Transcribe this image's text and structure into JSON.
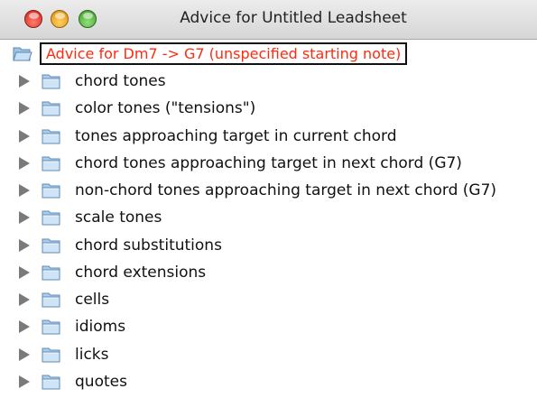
{
  "window": {
    "title": "Advice for Untitled Leadsheet"
  },
  "tree": {
    "root_label": "Advice for Dm7 -> G7 (unspecified starting note)",
    "root_color": "#ff2a10",
    "items": [
      {
        "label": "chord tones"
      },
      {
        "label": "color tones (\"tensions\")"
      },
      {
        "label": "tones approaching target in current chord"
      },
      {
        "label": "chord tones approaching target in next chord (G7)"
      },
      {
        "label": "non-chord tones approaching target in next chord (G7)"
      },
      {
        "label": "scale tones"
      },
      {
        "label": "chord substitutions"
      },
      {
        "label": "chord extensions"
      },
      {
        "label": "cells"
      },
      {
        "label": "idioms"
      },
      {
        "label": "licks"
      },
      {
        "label": "quotes"
      }
    ]
  },
  "icons": {
    "window_controls": [
      "close-icon",
      "minimize-icon",
      "zoom-icon"
    ],
    "node_expander": "disclosure-triangle-icon",
    "node_icon": "folder-icon"
  }
}
